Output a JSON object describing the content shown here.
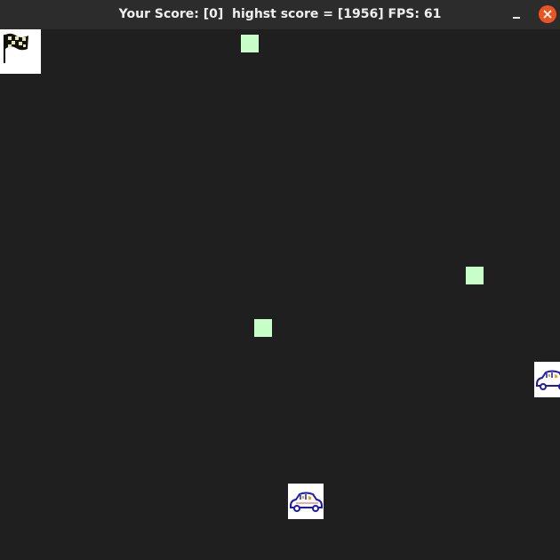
{
  "window": {
    "title": "Your Score: [0]  highst score = [1956] FPS: 61"
  },
  "game": {
    "score": 0,
    "high_score": 1956,
    "fps": 61,
    "sprites": {
      "goal": "checkered-flag-icon",
      "player": "car-icon",
      "enemy": "car-icon",
      "pickup": "green-square"
    },
    "colors": {
      "background": "#1f1f1f",
      "pickup": "#c8ffc8",
      "car_body": "#1a1ab4",
      "close_button": "#e95420"
    }
  }
}
